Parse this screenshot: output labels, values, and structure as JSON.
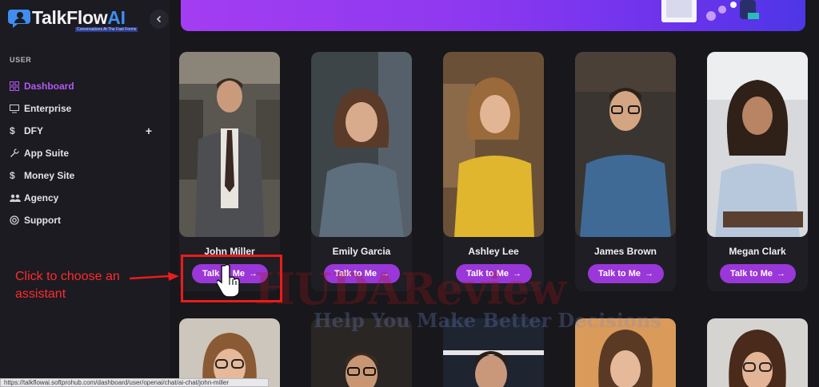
{
  "brand": {
    "name_main": "TalkFlow",
    "name_ai": "AI",
    "tagline": "Conversations At The Fast Forms"
  },
  "sidebar": {
    "section_label": "USER",
    "items": [
      {
        "label": "Dashboard",
        "icon": "grid-icon",
        "active": true
      },
      {
        "label": "Enterprise",
        "icon": "monitor-icon"
      },
      {
        "label": "DFY",
        "icon": "dollar-icon",
        "has_expand": true,
        "expand_symbol": "+"
      },
      {
        "label": "App Suite",
        "icon": "wrench-icon"
      },
      {
        "label": "Money Site",
        "icon": "dollar-icon"
      },
      {
        "label": "Agency",
        "icon": "users-icon"
      },
      {
        "label": "Support",
        "icon": "lifebuoy-icon"
      }
    ]
  },
  "assistants": [
    {
      "name": "John Miller",
      "button": "Talk to Me",
      "arrow": "→"
    },
    {
      "name": "Emily Garcia",
      "button": "Talk to Me",
      "arrow": "→"
    },
    {
      "name": "Ashley Lee",
      "button": "Talk to Me",
      "arrow": "→"
    },
    {
      "name": "James Brown",
      "button": "Talk to Me",
      "arrow": "→"
    },
    {
      "name": "Megan Clark",
      "button": "Talk to Me",
      "arrow": "→"
    }
  ],
  "annotation": {
    "text": "Click to choose an assistant"
  },
  "watermark": {
    "main": "HUDAReview",
    "sub": "Help You Make Better Decisions"
  },
  "status_url": "https://talkflowai.softprohub.com/dashboard/user/openai/chat/ai-chat/john-miller",
  "colors": {
    "accent": "#b457f5",
    "button": "#9a37d8",
    "background": "#17171c",
    "annotation": "#ea1c1c"
  }
}
